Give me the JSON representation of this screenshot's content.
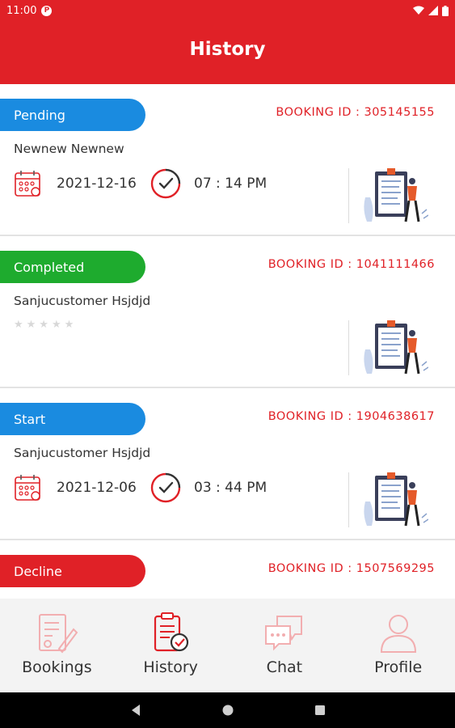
{
  "status_bar": {
    "time": "11:00"
  },
  "app_bar": {
    "title": "History"
  },
  "colors": {
    "brand_red": "#e02127",
    "pending_blue": "#1a8be0",
    "completed_green": "#1eab2e",
    "start_blue": "#1a8be0",
    "decline_red": "#e02127"
  },
  "bookings": [
    {
      "status": "Pending",
      "booking_id": "BOOKING ID : 305145155",
      "customer": "Newnew Newnew",
      "date": "2021-12-16",
      "time": "07 : 14 PM"
    },
    {
      "status": "Completed",
      "booking_id": "BOOKING ID : 1041111466",
      "customer": "Sanjucustomer Hsjdjd",
      "rating": "★★★★★",
      "rating_value": 0
    },
    {
      "status": "Start",
      "booking_id": "BOOKING ID : 1904638617",
      "customer": "Sanjucustomer Hsjdjd",
      "date": "2021-12-06",
      "time": "03 : 44 PM"
    },
    {
      "status": "Decline",
      "booking_id": "BOOKING ID : 1507569295"
    }
  ],
  "bottom_nav": {
    "items": [
      {
        "label": "Bookings",
        "icon": "bookings-icon",
        "active": false
      },
      {
        "label": "History",
        "icon": "history-icon",
        "active": true
      },
      {
        "label": "Chat",
        "icon": "chat-icon",
        "active": false
      },
      {
        "label": "Profile",
        "icon": "profile-icon",
        "active": false
      }
    ]
  },
  "system_nav": {
    "icons": [
      "back-icon",
      "home-icon",
      "recents-icon"
    ]
  }
}
